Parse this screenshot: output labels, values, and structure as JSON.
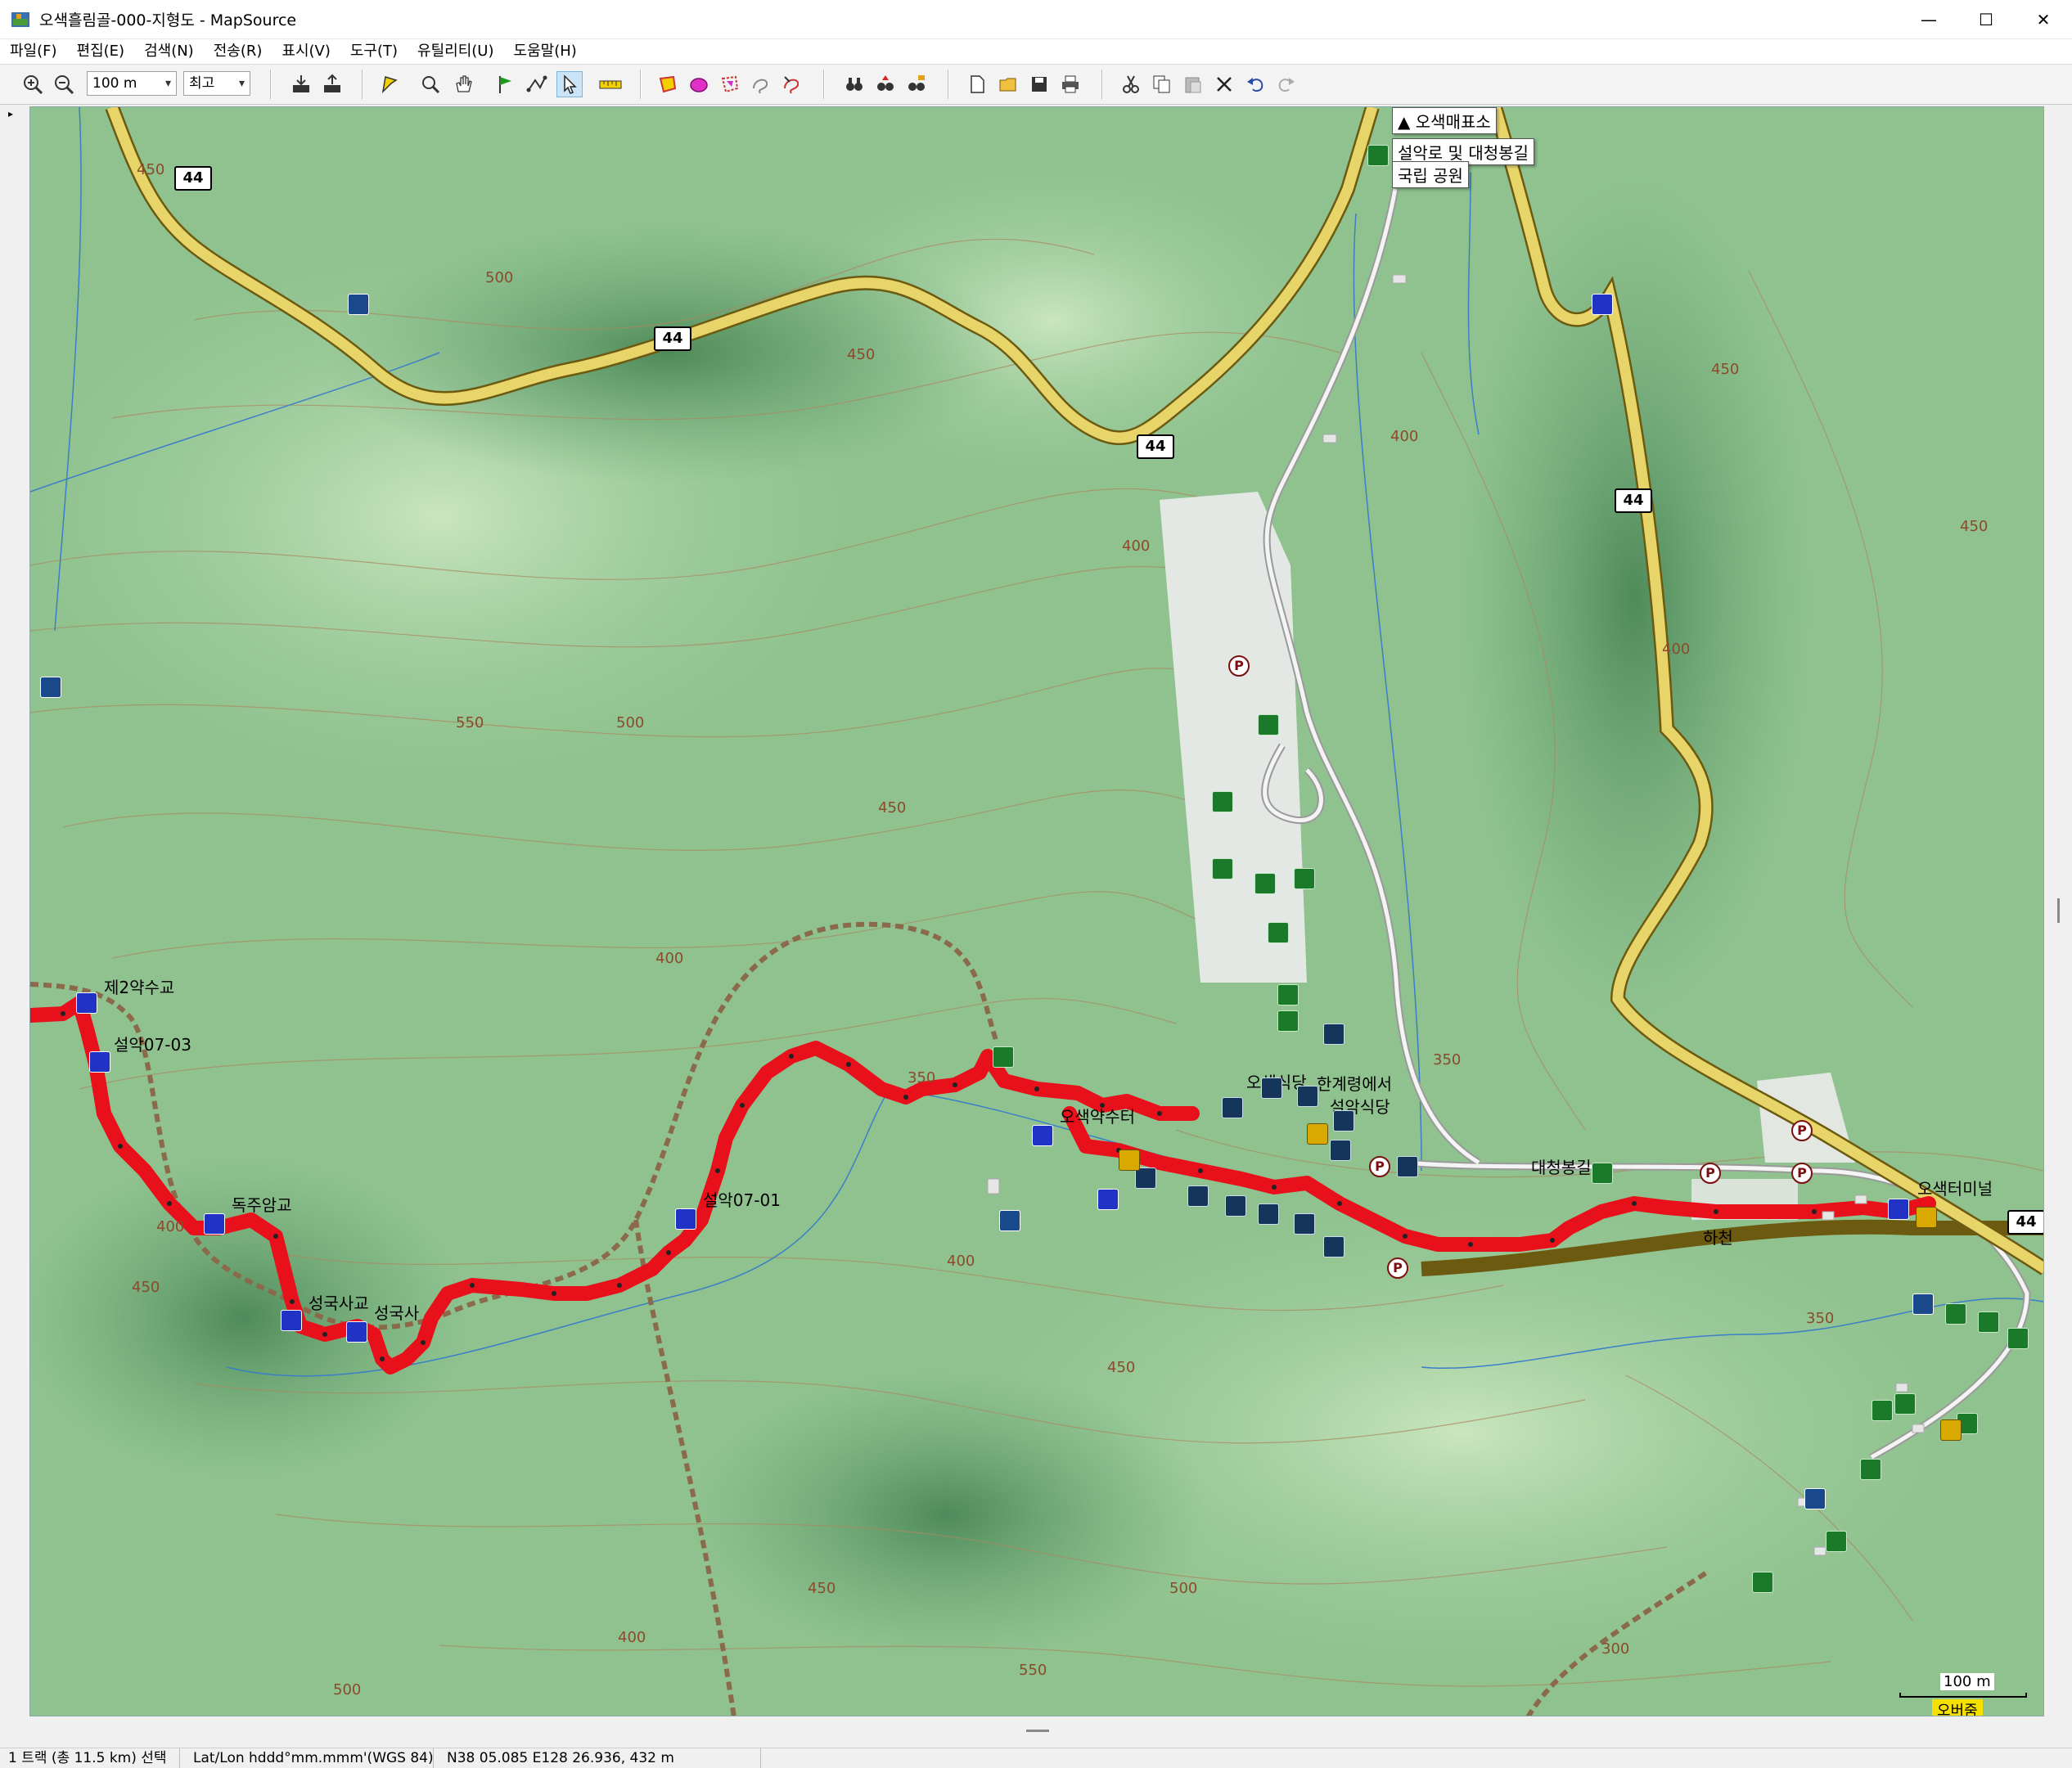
{
  "window": {
    "title": "오색흘림골-000-지형도 - MapSource",
    "minimize": "—",
    "maximize": "☐",
    "close": "✕"
  },
  "menu": [
    "파일(F)",
    "편집(E)",
    "검색(N)",
    "전송(R)",
    "표시(V)",
    "도구(T)",
    "유틸리티(U)",
    "도움말(H)"
  ],
  "toolbar": {
    "zoom_scale": "100 m",
    "detail_level": "최고"
  },
  "tooltip": {
    "items": [
      "오색매표소",
      "설악로 및 대청봉길",
      "국립 공원"
    ]
  },
  "highways": {
    "route_number": "44"
  },
  "waypoints": {
    "w1": "제2약수교",
    "w2": "설악07-03",
    "w3": "독주암교",
    "w4": "성국사교",
    "w5": "성국사",
    "w6": "설악07-01",
    "w7": "오색약수터",
    "w8": "오색터미널",
    "w9": "한계령에서",
    "w10": "설악식당",
    "w11": "대청봉길",
    "w12": "하천",
    "w13": "오색식당"
  },
  "contours": {
    "c1": "450",
    "c2": "500",
    "c3": "450",
    "c4": "400",
    "c5": "450",
    "c6": "400",
    "c7": "550",
    "c8": "500",
    "c9": "450",
    "c10": "400",
    "c11": "400",
    "c12": "350",
    "c13": "400",
    "c14": "450",
    "c15": "350",
    "c16": "450",
    "c17": "500",
    "c18": "450",
    "c19": "400",
    "c20": "500",
    "c21": "550",
    "c22": "300",
    "c23": "450",
    "c24": "350",
    "c25": "400"
  },
  "scale_bar": {
    "distance": "100 m",
    "mode": "오버줌"
  },
  "status": {
    "selection": "1 트랙 (총 11.5 km) 선택",
    "format": "Lat/Lon hddd°mm.mmm'(WGS 84)",
    "position": "N38 05.085 E128 26.936, 432 m"
  },
  "colors": {
    "terrain": "#8fc28f",
    "road": "#e8d56a",
    "track": "#e8101a",
    "poi_blue": "#2036c8"
  }
}
